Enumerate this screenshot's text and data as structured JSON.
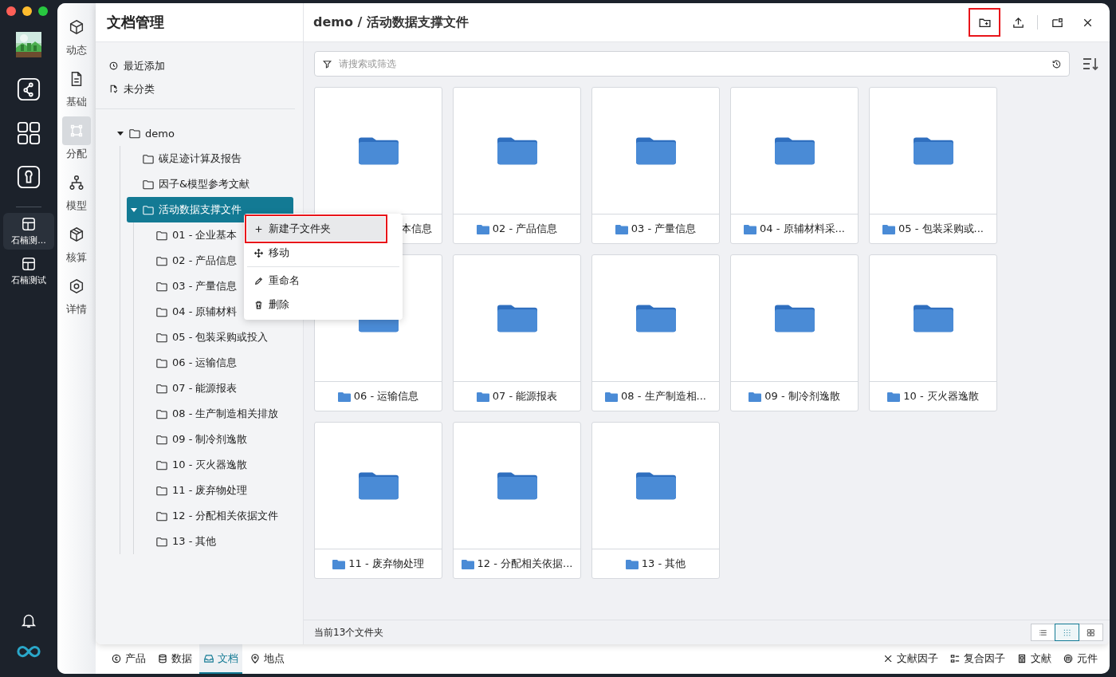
{
  "workspaces": [
    {
      "label": "石楠测...",
      "selected": true
    },
    {
      "label": "石楠测试",
      "selected": false
    }
  ],
  "modules": [
    {
      "kind": "cube",
      "label": "动态",
      "selected": false
    },
    {
      "kind": "doc",
      "label": "基础",
      "selected": false
    },
    {
      "kind": "distribute",
      "label": "分配",
      "selected": true
    },
    {
      "kind": "hierarchy",
      "label": "模型",
      "selected": false
    },
    {
      "kind": "box",
      "label": "核算",
      "selected": false
    },
    {
      "kind": "hex",
      "label": "详情",
      "selected": false
    }
  ],
  "panel_title": "文档管理",
  "quick_links": [
    {
      "kind": "recent",
      "label": "最近添加"
    },
    {
      "kind": "unsorted",
      "label": "未分类"
    }
  ],
  "tree": [
    {
      "label": "demo",
      "expanded": true,
      "selected": false,
      "children": [
        {
          "label": "碳足迹计算及报告",
          "selected": false
        },
        {
          "label": "因子&模型参考文献",
          "selected": false
        },
        {
          "label": "活动数据支撑文件",
          "expanded": true,
          "selected": true,
          "children": [
            {
              "label": "01 - 企业基本",
              "selected": false
            },
            {
              "label": "02 - 产品信息",
              "selected": false
            },
            {
              "label": "03 - 产量信息",
              "selected": false
            },
            {
              "label": "04 - 原辅材料",
              "selected": false
            },
            {
              "label": "05 - 包装采购或投入",
              "selected": false
            },
            {
              "label": "06 - 运输信息",
              "selected": false
            },
            {
              "label": "07 - 能源报表",
              "selected": false
            },
            {
              "label": "08 - 生产制造相关排放",
              "selected": false
            },
            {
              "label": "09 - 制冷剂逸散",
              "selected": false
            },
            {
              "label": "10 - 灭火器逸散",
              "selected": false
            },
            {
              "label": "11 - 废弃物处理",
              "selected": false
            },
            {
              "label": "12 - 分配相关依据文件",
              "selected": false
            },
            {
              "label": "13 - 其他",
              "selected": false
            }
          ]
        }
      ]
    }
  ],
  "context_menu": {
    "items": [
      {
        "kind": "add",
        "label": "新建子文件夹",
        "hovered": true,
        "annotated": true,
        "divider_before": false
      },
      {
        "kind": "move",
        "label": "移动",
        "hovered": false,
        "annotated": false,
        "divider_before": false
      },
      {
        "kind": "rename",
        "label": "重命名",
        "hovered": false,
        "annotated": false,
        "divider_before": true
      },
      {
        "kind": "delete",
        "label": "删除",
        "hovered": false,
        "annotated": false,
        "divider_before": false
      }
    ]
  },
  "breadcrumb": "demo / 活动数据支撑文件",
  "toolbar": [
    {
      "kind": "new-folder",
      "annotated": true
    },
    {
      "kind": "upload",
      "annotated": false
    },
    {
      "kind": "window",
      "annotated": false
    },
    {
      "kind": "close",
      "annotated": false
    }
  ],
  "search": {
    "placeholder": "请搜索或筛选"
  },
  "folders": [
    {
      "label": "本信息",
      "partly_hidden": true
    },
    {
      "label": "02 - 产品信息",
      "partly_hidden": false
    },
    {
      "label": "03 - 产量信息",
      "partly_hidden": false
    },
    {
      "label": "04 - 原辅材料采...",
      "partly_hidden": false
    },
    {
      "label": "05 - 包装采购或...",
      "partly_hidden": false
    },
    {
      "label": "06 - 运输信息",
      "partly_hidden": false
    },
    {
      "label": "07 - 能源报表",
      "partly_hidden": false
    },
    {
      "label": "08 - 生产制造相...",
      "partly_hidden": false
    },
    {
      "label": "09 - 制冷剂逸散",
      "partly_hidden": false
    },
    {
      "label": "10 - 灭火器逸散",
      "partly_hidden": false
    },
    {
      "label": "11 - 废弃物处理",
      "partly_hidden": false
    },
    {
      "label": "12 - 分配相关依据...",
      "partly_hidden": false
    },
    {
      "label": "13 - 其他",
      "partly_hidden": false
    }
  ],
  "status": "当前13个文件夹",
  "views": [
    {
      "kind": "list",
      "selected": false
    },
    {
      "kind": "grid",
      "selected": true
    },
    {
      "kind": "large",
      "selected": false
    }
  ],
  "bottom_tabs": [
    {
      "kind": "product",
      "label": "产品",
      "selected": false
    },
    {
      "kind": "data",
      "label": "数据",
      "selected": false
    },
    {
      "kind": "docs",
      "label": "文档",
      "selected": true
    },
    {
      "kind": "place",
      "label": "地点",
      "selected": false
    }
  ],
  "bottom_links": [
    {
      "kind": "factor",
      "label": "文献因子"
    },
    {
      "kind": "compound",
      "label": "复合因子"
    },
    {
      "kind": "literature",
      "label": "文献"
    },
    {
      "kind": "component",
      "label": "元件"
    }
  ]
}
